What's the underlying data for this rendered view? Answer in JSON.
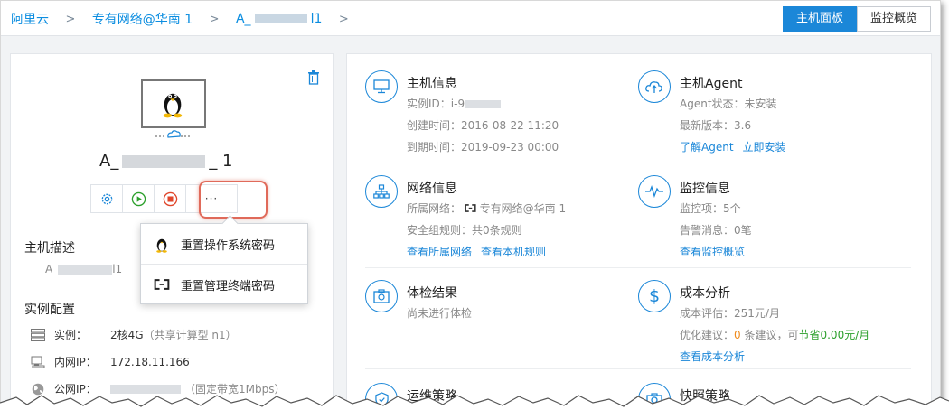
{
  "breadcrumb": {
    "root": "阿里云",
    "region": "专有网络@华南 1",
    "instance_prefix": "A_",
    "instance_suffix": "l1"
  },
  "view_toggle": {
    "host_panel": "主机面板",
    "monitor_overview": "监控概览"
  },
  "instance": {
    "name_prefix": "A_",
    "name_suffix": "_  1",
    "more_label": "···"
  },
  "popup_menu": {
    "reset_os_password": "重置操作系统密码",
    "reset_terminal_password": "重置管理终端密码"
  },
  "description": {
    "title": "主机描述",
    "value_prefix": "A_",
    "value_suffix": "l1"
  },
  "config": {
    "title": "实例配置",
    "instance_label": "实例：",
    "instance_value": "2核4G",
    "instance_type": "（共享计算型 n1）",
    "private_ip_label": "内网IP：",
    "private_ip_value": "172.18.11.166",
    "public_ip_label": "公网IP：",
    "public_ip_note": "（固定带宽1Mbps）"
  },
  "host_info": {
    "title": "主机信息",
    "instance_id": "实例ID：i-9",
    "created": "创建时间：2016-08-22 11:20",
    "expires": "到期时间：2019-09-23 00:00"
  },
  "agent": {
    "title": "主机Agent",
    "status": "Agent状态：未安装",
    "version": "最新版本：3.6",
    "learn_link": "了解Agent",
    "install_link": "立即安装"
  },
  "network": {
    "title": "网络信息",
    "network_label": "所属网络：",
    "network_value": "专有网络@华南 1",
    "security_rules": "安全组规则：共0条规则",
    "view_network_link": "查看所属网络",
    "view_rules_link": "查看本机规则"
  },
  "monitor": {
    "title": "监控信息",
    "items": "监控项：5个",
    "alerts": "告警消息：0笔",
    "link": "查看监控概览"
  },
  "check": {
    "title": "体检结果",
    "status": "尚未进行体检"
  },
  "cost": {
    "title": "成本分析",
    "estimate": "成本评估：251元/月",
    "advice_prefix": "优化建议：",
    "advice_count": "0",
    "advice_mid": " 条建议，可",
    "advice_save": "节省0.00元/月",
    "link": "查看成本分析"
  },
  "ops": {
    "title": "运维策略"
  },
  "snapshot": {
    "title": "快照策略"
  },
  "colors": {
    "accent": "#1b87d8",
    "highlight": "#e06a5a",
    "orange": "#f08c1e",
    "green": "#2ca02c"
  },
  "icons": [
    "trash-icon",
    "linux-penguin-icon",
    "cloud-link-icon",
    "gear-icon",
    "play-icon",
    "stop-icon",
    "monitor-icon",
    "cloud-upload-icon",
    "network-tree-icon",
    "pulse-icon",
    "checkup-icon",
    "dollar-icon",
    "shield-icon",
    "camera-icon",
    "server-icon",
    "lan-icon",
    "globe-icon",
    "link-icon"
  ]
}
